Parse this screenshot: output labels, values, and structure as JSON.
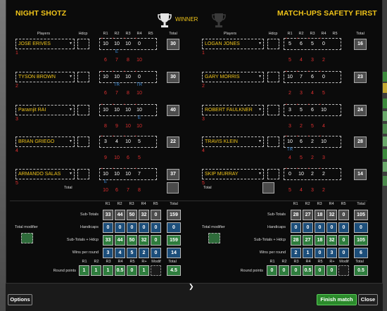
{
  "header": {
    "team_left": "NIGHT SHOTZ",
    "team_right": "MATCH-UPS SAFETY FIRST",
    "winner_label": "WINNER"
  },
  "column_headers": {
    "players": "Players",
    "hdcp": "Hdcp",
    "rounds": [
      "R1",
      "R2",
      "R3",
      "R4",
      "R5"
    ],
    "total": "Total"
  },
  "left_team": {
    "players": [
      {
        "index": "1",
        "name": "JOSE ERIVES",
        "scores": [
          "10",
          "10",
          "10",
          "0",
          ""
        ],
        "marks": [
          "",
          "",
          "",
          "",
          ""
        ],
        "sub": [
          "",
          "E",
          "",
          "",
          ""
        ],
        "par": [
          "6",
          "7",
          "8",
          "10",
          ""
        ],
        "total": "30"
      },
      {
        "index": "2",
        "name": "TYSON BROWN",
        "scores": [
          "10",
          "10",
          "10",
          "0",
          ""
        ],
        "marks": [
          "",
          "",
          "",
          "",
          ""
        ],
        "sub": [
          "",
          "TR",
          "",
          "TR",
          ""
        ],
        "par": [
          "6",
          "7",
          "8",
          "10",
          ""
        ],
        "total": "30"
      },
      {
        "index": "3",
        "name": "Paramjit RAI",
        "scores": [
          "10",
          "10",
          "10",
          "10",
          ""
        ],
        "marks": [
          "",
          "",
          "",
          "",
          ""
        ],
        "sub": [
          "",
          "",
          "",
          "E",
          ""
        ],
        "par": [
          "8",
          "9",
          "10",
          "10",
          ""
        ],
        "total": "40"
      },
      {
        "index": "4",
        "name": "BRIAN GRIEGO",
        "scores": [
          "3",
          "4",
          "10",
          "5",
          ""
        ],
        "marks": [
          "",
          "",
          "",
          "",
          ""
        ],
        "sub": [
          "",
          "",
          "",
          "",
          ""
        ],
        "par": [
          "9",
          "10",
          "6",
          "5",
          ""
        ],
        "total": "22"
      },
      {
        "index": "5",
        "name": "ARMANDO SALAS",
        "scores": [
          "10",
          "10",
          "10",
          "7",
          ""
        ],
        "marks": [
          "",
          "",
          "",
          "",
          ""
        ],
        "sub": [
          "E",
          "",
          "",
          "",
          ""
        ],
        "par": [
          "10",
          "6",
          "7",
          "8",
          ""
        ],
        "total": "37"
      }
    ],
    "total_label": "Total",
    "summary": {
      "subtotals": {
        "label": "Sub-Totals",
        "values": [
          "33",
          "44",
          "50",
          "32",
          "0"
        ],
        "total": "159"
      },
      "handicaps": {
        "label": "Handicaps",
        "values": [
          "0",
          "0",
          "0",
          "0",
          "0"
        ],
        "total": "0"
      },
      "subtotals_hdcp": {
        "label": "Sub-Totals + Hdcp",
        "values": [
          "33",
          "44",
          "50",
          "32",
          "0"
        ],
        "total": "159"
      },
      "wins": {
        "label": "Wins per round",
        "values": [
          "3",
          "4",
          "5",
          "2",
          "0"
        ],
        "total": "14"
      },
      "round_points_headers": [
        "R1",
        "R2",
        "R3",
        "R4",
        "R5",
        "R+",
        "Modif",
        "Total"
      ],
      "round_points": {
        "label": "Round points",
        "values": [
          "1",
          "1",
          "1",
          "0.5",
          "0",
          "1",
          ""
        ],
        "total": "4.5"
      }
    },
    "modifier_label": "Total modifier"
  },
  "right_team": {
    "players": [
      {
        "index": "1",
        "name": "LOGAN JONES",
        "scores": [
          "5",
          "6",
          "5",
          "0",
          ""
        ],
        "marks": [
          "",
          "",
          "",
          "",
          ""
        ],
        "sub": [
          "",
          "",
          "",
          "",
          ""
        ],
        "par": [
          "5",
          "4",
          "3",
          "2",
          ""
        ],
        "total": "16"
      },
      {
        "index": "2",
        "name": "GARY MORRIS",
        "scores": [
          "10",
          "7",
          "6",
          "0",
          ""
        ],
        "marks": [
          "",
          "",
          "",
          "",
          ""
        ],
        "sub": [
          "",
          "",
          "",
          "",
          ""
        ],
        "par": [
          "2",
          "3",
          "4",
          "5",
          ""
        ],
        "total": "23"
      },
      {
        "index": "3",
        "name": "ROBERT FAULKNER",
        "scores": [
          "3",
          "5",
          "6",
          "10",
          ""
        ],
        "marks": [
          "",
          "",
          "",
          "",
          ""
        ],
        "sub": [
          "",
          "",
          "",
          "",
          ""
        ],
        "par": [
          "3",
          "2",
          "5",
          "4",
          ""
        ],
        "total": "24"
      },
      {
        "index": "4",
        "name": "TRAVIS KLEIN",
        "scores": [
          "10",
          "6",
          "2",
          "10",
          ""
        ],
        "marks": [
          "",
          "",
          "",
          "",
          ""
        ],
        "sub": [
          "TR",
          "",
          "",
          "",
          ""
        ],
        "par": [
          "4",
          "5",
          "2",
          "3",
          ""
        ],
        "total": "28"
      },
      {
        "index": "5",
        "name": "SKIP MURRAY",
        "scores": [
          "0",
          "10",
          "2",
          "2",
          ""
        ],
        "marks": [
          "",
          "",
          "",
          "",
          ""
        ],
        "sub": [
          "",
          "",
          "",
          "",
          ""
        ],
        "par": [
          "5",
          "4",
          "3",
          "2",
          ""
        ],
        "total": "14"
      }
    ],
    "total_label": "Total",
    "summary": {
      "subtotals": {
        "label": "Sub-Totals",
        "values": [
          "28",
          "27",
          "18",
          "32",
          "0"
        ],
        "total": "105"
      },
      "handicaps": {
        "label": "Handicaps",
        "values": [
          "0",
          "0",
          "0",
          "0",
          "0"
        ],
        "total": "0"
      },
      "subtotals_hdcp": {
        "label": "Sub-Totals + Hdcp",
        "values": [
          "28",
          "27",
          "18",
          "32",
          "0"
        ],
        "total": "105"
      },
      "wins": {
        "label": "Wins per round",
        "values": [
          "2",
          "1",
          "0",
          "3",
          "0"
        ],
        "total": "6"
      },
      "round_points_headers": [
        "R1",
        "R2",
        "R3",
        "R4",
        "R5",
        "R+",
        "Modif",
        "Total"
      ],
      "round_points": {
        "label": "Round points",
        "values": [
          "0",
          "0",
          "0",
          "0.5",
          "0",
          "0",
          ""
        ],
        "total": "0.5"
      }
    },
    "modifier_label": "Total modifier"
  },
  "footer": {
    "options_label": "Options",
    "finish_label": "Finish match",
    "close_label": "Close",
    "expand_icon": "chevron-down-icon"
  },
  "colors": {
    "title": "#f0c419",
    "accent_red": "#e03030",
    "accent_blue": "#3b8fe0",
    "cell_blue": "#1c4e7a",
    "cell_green": "#2e7d3d",
    "finish_button": "#2b8a2b"
  }
}
